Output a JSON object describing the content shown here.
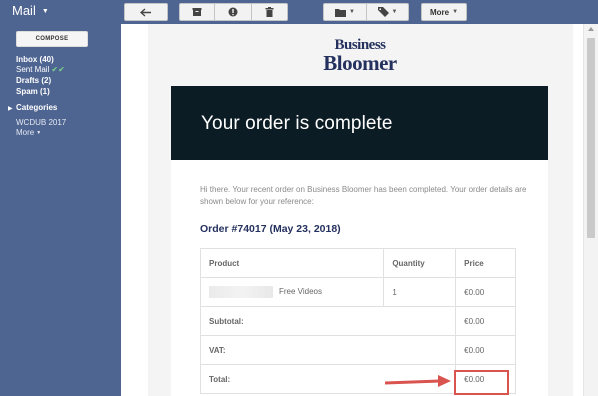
{
  "header": {
    "app_title": "Mail",
    "more_label": "More"
  },
  "toolbar": {
    "icons": [
      "reply-icon",
      "archive-icon",
      "report-spam-icon",
      "delete-icon",
      "folder-icon",
      "label-icon"
    ]
  },
  "sidebar": {
    "compose_label": "COMPOSE",
    "items": [
      {
        "label": "Inbox (40)",
        "bold": true
      },
      {
        "label": "Sent Mail",
        "bold": false
      },
      {
        "label": "Drafts (2)",
        "bold": true
      },
      {
        "label": "Spam (1)",
        "bold": true
      }
    ],
    "categories_label": "Categories",
    "extra_label": "WCDUB 2017",
    "more_label": "More"
  },
  "email": {
    "logo_line1": "Business",
    "logo_line2": "Bloomer",
    "banner_title": "Your order is complete",
    "intro_text": "Hi there. Your recent order on Business Bloomer has been completed. Your order details are shown below for your reference:",
    "order_heading": "Order #74017 (May 23, 2018)",
    "table": {
      "headers": [
        "Product",
        "Quantity",
        "Price"
      ],
      "item": {
        "name": "Free Videos",
        "quantity": "1",
        "price": "€0.00"
      },
      "subtotal_label": "Subtotal:",
      "subtotal_value": "€0.00",
      "vat_label": "VAT:",
      "vat_value": "€0.00",
      "total_label": "Total:",
      "total_value": "€0.00"
    }
  },
  "colors": {
    "sidebar_bg": "#4f6591",
    "banner_bg": "#0c1c25",
    "brand_navy": "#24305e",
    "highlight_red": "#d9534f",
    "sent_check": "#7bd389"
  }
}
